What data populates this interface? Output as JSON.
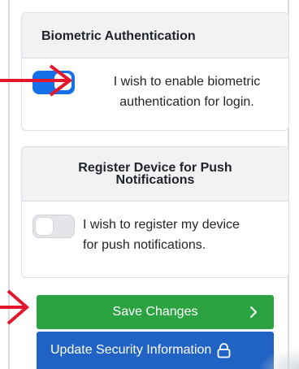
{
  "biometric": {
    "title": "Biometric Authentication",
    "toggle_on": true,
    "option_line1": "I wish to enable biometric",
    "option_line2": "authentication for login."
  },
  "push": {
    "title_line1": "Register Device for Push",
    "title_line2": "Notifications",
    "toggle_on": false,
    "option_line1": "I wish to register my device",
    "option_line2": "for push notifications."
  },
  "actions": {
    "save_label": "Save Changes",
    "update_label": "Update Security Information"
  },
  "icons": {
    "save": "chevron-right-icon",
    "update": "lock-icon",
    "annotation": "red-arrow-icon"
  },
  "colors": {
    "toggle_on": "#1671e8",
    "save_button": "#2ba341",
    "update_button": "#2163c4",
    "annotation_arrow": "#e3162b"
  }
}
